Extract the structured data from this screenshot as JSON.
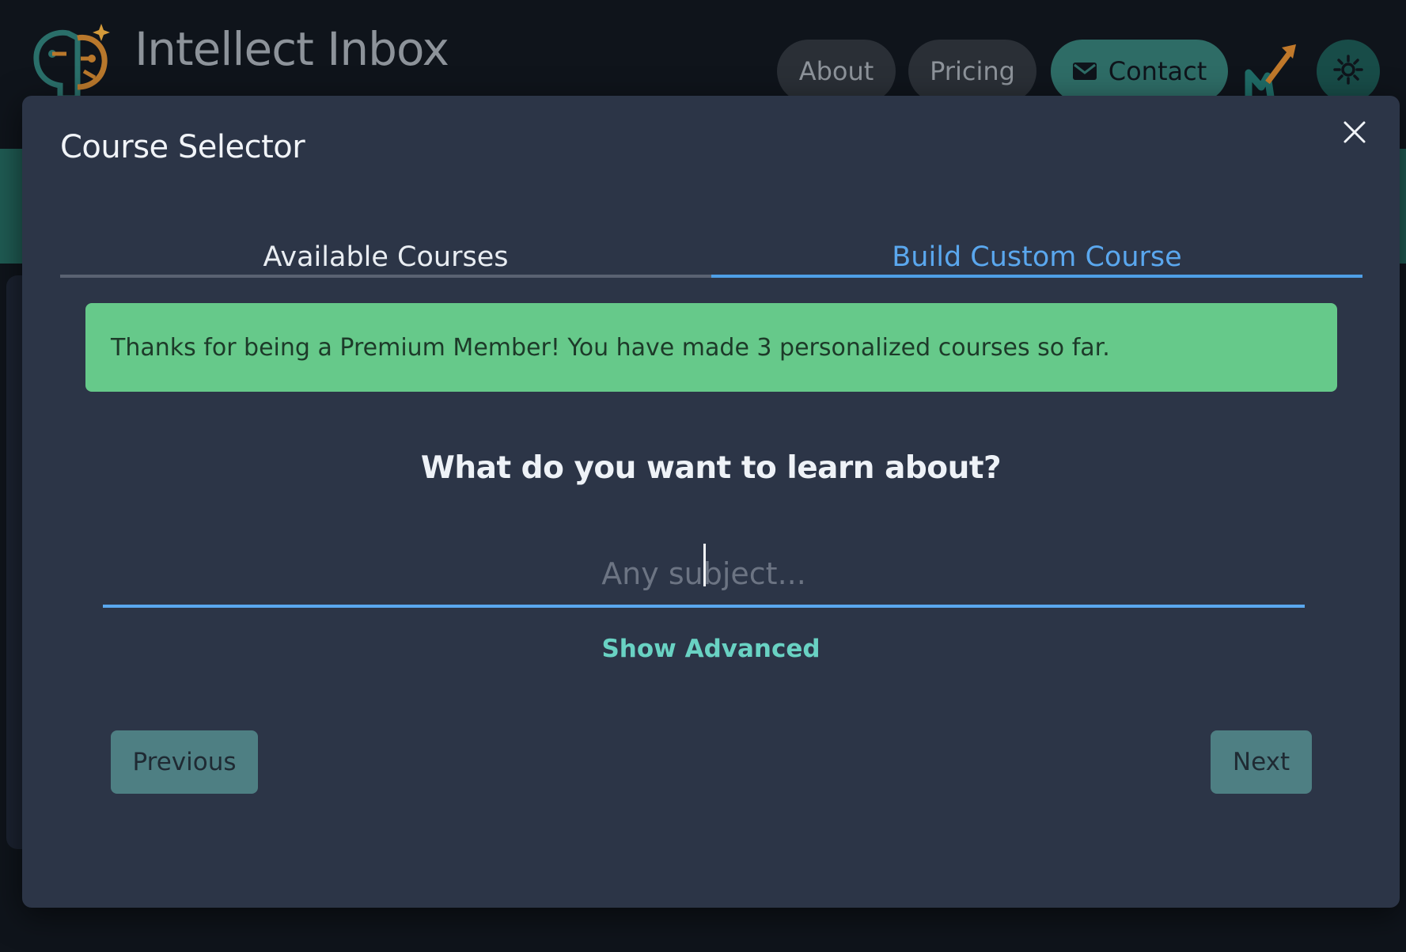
{
  "app": {
    "title": "Intellect Inbox"
  },
  "nav": {
    "about": "About",
    "pricing": "Pricing",
    "contact": "Contact"
  },
  "modal": {
    "title": "Course Selector",
    "tabs": [
      {
        "label": "Available Courses",
        "active": false
      },
      {
        "label": "Build Custom Course",
        "active": true
      }
    ],
    "alert": "Thanks for being a Premium Member! You have made 3 personalized courses so far.",
    "question": "What do you want to learn about?",
    "input": {
      "value": "",
      "placeholder": "Any subject..."
    },
    "advanced_link": "Show Advanced",
    "buttons": {
      "previous": "Previous",
      "next": "Next"
    }
  },
  "colors": {
    "accent_blue": "#4f9fe6",
    "success_green": "#66c98a",
    "teal_link": "#69d2c3",
    "button_teal": "#4e7f83",
    "modal_bg": "#2c3547"
  },
  "icons": [
    "brain-logo-icon",
    "envelope-icon",
    "growth-chart-icon",
    "sun-icon",
    "close-icon"
  ]
}
